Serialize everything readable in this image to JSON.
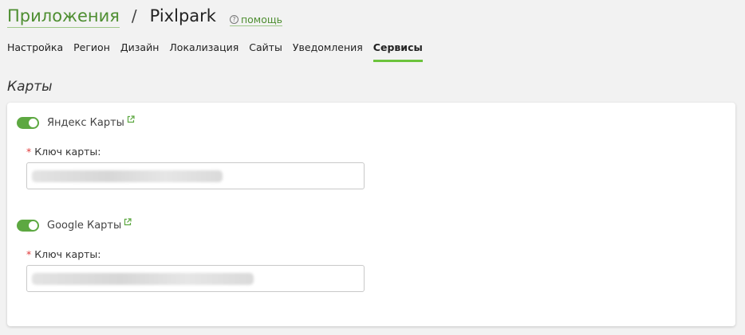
{
  "breadcrumb": {
    "parent": "Приложения",
    "separator": "/",
    "current": "Pixlpark",
    "help_icon": "?",
    "help": "помощь"
  },
  "tabs": [
    {
      "label": "Настройка",
      "active": false
    },
    {
      "label": "Регион",
      "active": false
    },
    {
      "label": "Дизайн",
      "active": false
    },
    {
      "label": "Локализация",
      "active": false
    },
    {
      "label": "Сайты",
      "active": false
    },
    {
      "label": "Уведомления",
      "active": false
    },
    {
      "label": "Сервисы",
      "active": true
    }
  ],
  "section": {
    "title": "Карты"
  },
  "services": [
    {
      "name": "Яндекс Карты",
      "enabled": true,
      "required_mark": "*",
      "field_label": "Ключ карты:",
      "value": "••••••••••••••••••••••••••••••••••••"
    },
    {
      "name": "Google Карты",
      "enabled": true,
      "required_mark": "*",
      "field_label": "Ключ карты:",
      "value": "••••••••••••••••••••••••••••••••••••••••"
    }
  ],
  "colors": {
    "accent": "#4e8e31",
    "toggle_on": "#5da841",
    "tab_underline": "#6cc33c",
    "required": "#e03a3a"
  }
}
